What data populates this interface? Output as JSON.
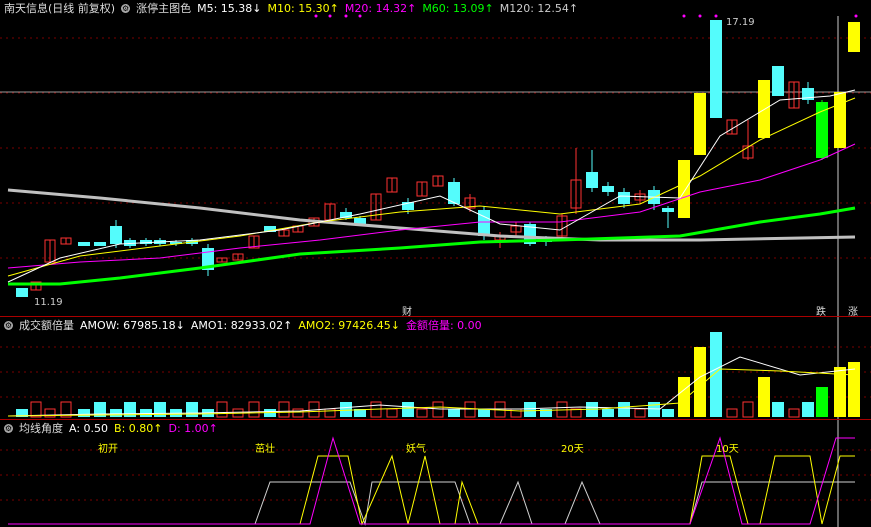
{
  "main": {
    "title": "南天信息(日线 前复权)",
    "indicator": "涨停主图色",
    "m5": "M5: 15.38↓",
    "m10": "M10: 15.30↑",
    "m20": "M20: 14.32↑",
    "m60": "M60: 13.09↑",
    "m120": "M120: 12.54↑",
    "high_label": "17.19",
    "low_label": "11.19",
    "marker_cai": "财",
    "marker_die": "跌",
    "marker_zhang": "涨"
  },
  "volume": {
    "title": "成交额倍量",
    "amow": "AMOW: 67985.18↓",
    "amo1": "AMO1: 82933.02↑",
    "amo2": "AMO2: 97426.45↓",
    "bei": "金额倍量: 0.00",
    "bei_mark": "倍"
  },
  "angle": {
    "title": "均线角度",
    "a": "A: 0.50",
    "b": "B: 0.80↑",
    "d": "D: 1.00↑",
    "labels": [
      "初开",
      "茁壮",
      "妖气",
      "20天",
      "10天"
    ]
  },
  "colors": {
    "up": "#ff3232",
    "down": "#54fcfc",
    "limit": "#ffff00",
    "green": "#00ff00",
    "magenta": "#ff00ff",
    "m60": "#00ff00",
    "m120": "#c0c0c0"
  }
}
